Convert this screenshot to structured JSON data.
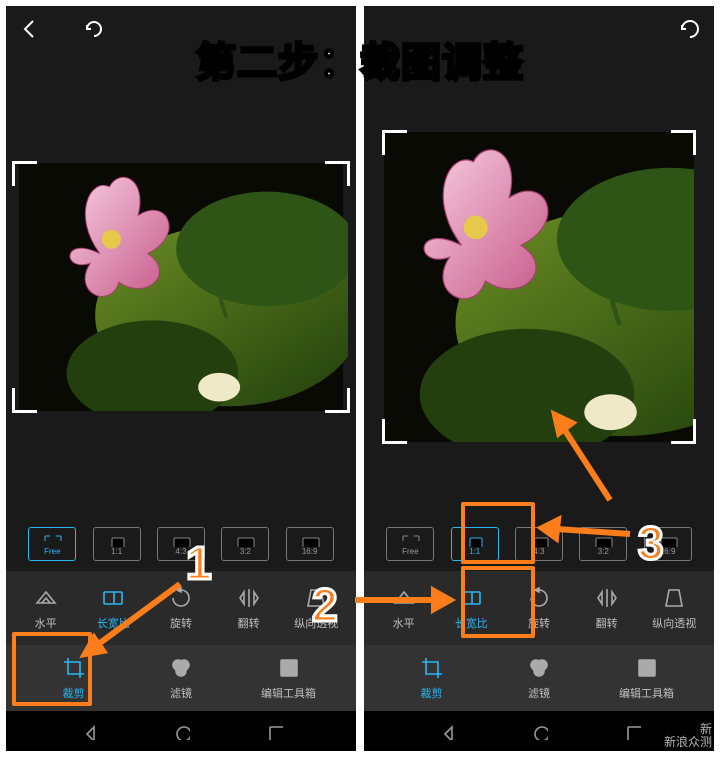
{
  "overlay": {
    "title": "第二步：裁图调整",
    "markers": {
      "n1": "1",
      "n2": "2",
      "n3": "3"
    },
    "watermark_top": "新",
    "watermark_main": "新浪众测"
  },
  "left": {
    "ratios": {
      "free": "Free",
      "r11": "1:1",
      "r43": "4:3",
      "r32": "3:2",
      "r169": "16:9"
    },
    "tools": {
      "level": "水平",
      "aspect": "长宽比",
      "rotate": "旋转",
      "flip": "翻转",
      "persp_v": "纵向透视"
    },
    "tabs": {
      "crop": "裁剪",
      "filter": "滤镜",
      "tools": "编辑工具箱"
    }
  },
  "right": {
    "ratios": {
      "free": "Free",
      "r11": "1:1",
      "r43": "4:3",
      "r32": "3:2",
      "r169": "16:9"
    },
    "tools": {
      "level": "水平",
      "aspect": "长宽比",
      "rotate": "旋转",
      "flip": "翻转",
      "persp_v": "纵向透视"
    },
    "tabs": {
      "crop": "裁剪",
      "filter": "滤镜",
      "tools": "编辑工具箱"
    }
  }
}
